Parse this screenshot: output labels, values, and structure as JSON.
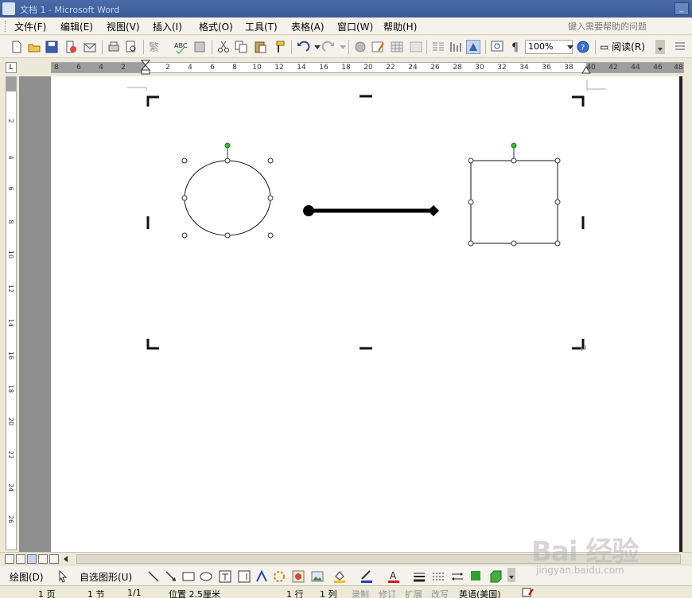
{
  "window": {
    "title": "文档 1 - Microsoft Word",
    "minimize_glyph": "_"
  },
  "menu": {
    "items": [
      "文件(F)",
      "编辑(E)",
      "视图(V)",
      "插入(I)",
      "格式(O)",
      "工具(T)",
      "表格(A)",
      "窗口(W)",
      "帮助(H)"
    ],
    "help_placeholder": "键入需要帮助的问题"
  },
  "toolbar": {
    "zoom": "100%",
    "read_label": "阅读(R)",
    "icons": [
      "new-document-icon",
      "open-icon",
      "save-icon",
      "permission-icon",
      "email-icon",
      "print-icon",
      "print-preview-icon",
      "research-icon",
      "spelling-icon",
      "cut-icon",
      "copy-icon",
      "paste-icon",
      "format-painter-icon",
      "undo-icon",
      "redo-icon",
      "hyperlink-icon",
      "tables-borders-icon",
      "insert-table-icon",
      "columns-icon",
      "drawing-icon",
      "document-map-icon",
      "show-hide-icon",
      "help-icon"
    ]
  },
  "ruler": {
    "corner_label": "L",
    "labels": [
      "8",
      "6",
      "4",
      "2",
      "2",
      "4",
      "6",
      "8",
      "10",
      "12",
      "14",
      "16",
      "18",
      "20",
      "22",
      "24",
      "26",
      "28",
      "30",
      "32",
      "34",
      "36",
      "38",
      "40",
      "42",
      "44",
      "46",
      "48"
    ],
    "vlabels": [
      "2",
      "4",
      "6",
      "8",
      "10",
      "12",
      "14",
      "16",
      "18",
      "20",
      "22",
      "24",
      "26"
    ]
  },
  "drawing": {
    "draw_label": "绘图(D)",
    "autoshapes_label": "自选图形(U)",
    "colors": {
      "fill": "#f0c000",
      "line": "#2040c0",
      "font": "#e01010",
      "shadow": "#30a030"
    }
  },
  "status": {
    "page": "1 页",
    "section": "1 节",
    "page_of": "1/1",
    "position": "位置 2.5厘米",
    "line": "1 行",
    "column": "1 列",
    "rec": "录制",
    "trk": "修订",
    "ext": "扩展",
    "ovr": "改写",
    "language": "英语(美国)"
  },
  "watermark": {
    "brand": "Bai 经验",
    "url": "jingyan.baidu.com"
  }
}
